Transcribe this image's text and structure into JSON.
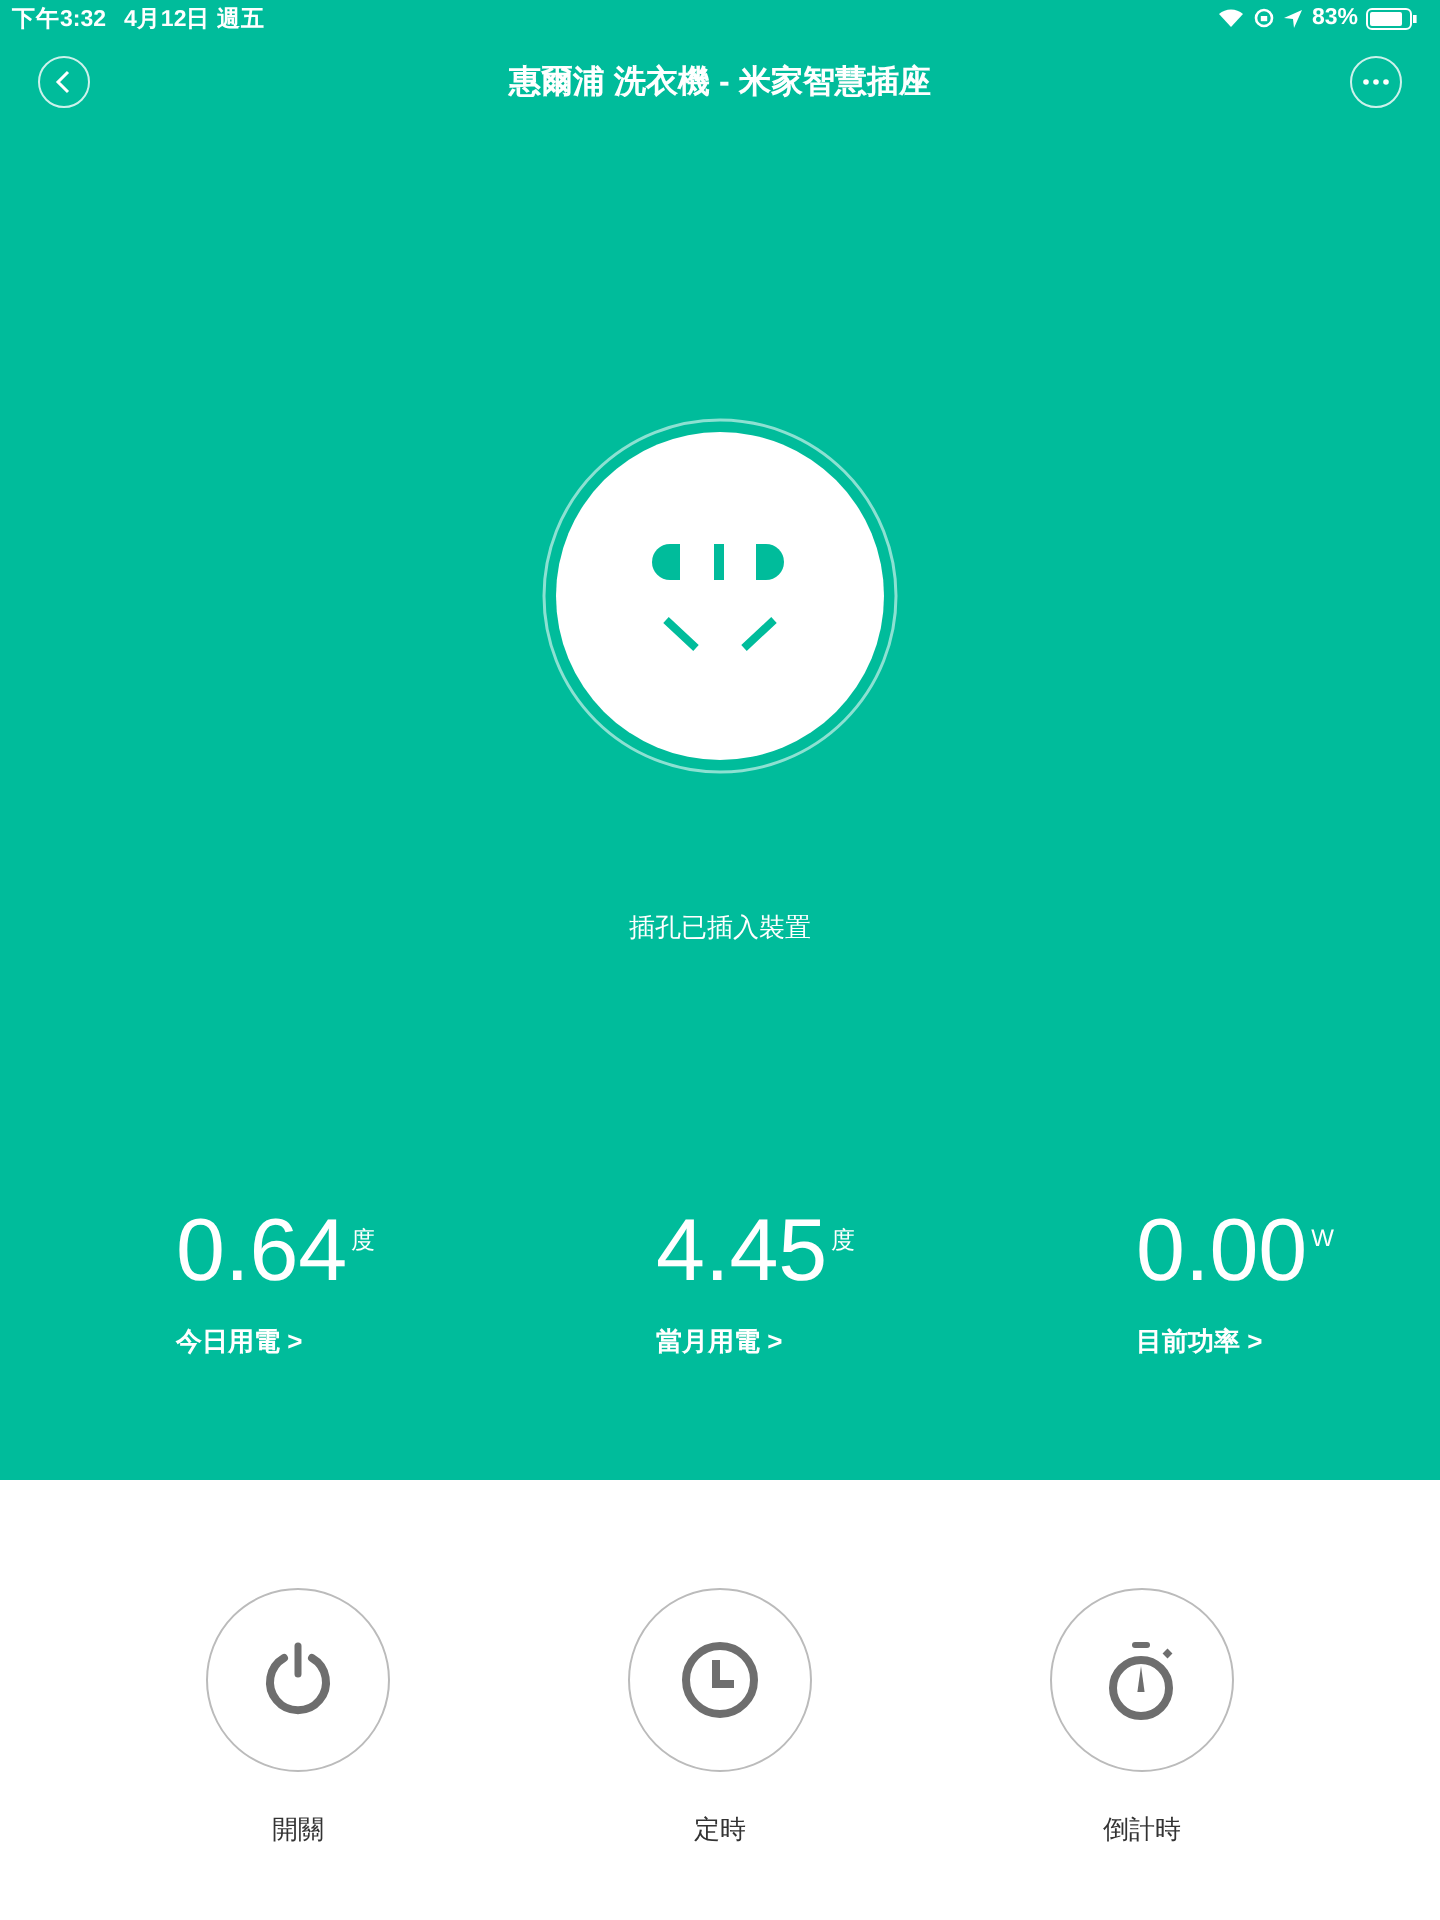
{
  "status_bar": {
    "time": "下午3:32",
    "date": "4月12日 週五",
    "battery": "83%"
  },
  "header": {
    "title": "惠爾浦 洗衣機 - 米家智慧插座"
  },
  "socket": {
    "status": "插孔已插入裝置"
  },
  "stats": [
    {
      "value": "0.64",
      "unit": "度",
      "label": "今日用電 >"
    },
    {
      "value": "4.45",
      "unit": "度",
      "label": "當月用電 >"
    },
    {
      "value": "0.00",
      "unit": "W",
      "label": "目前功率 >"
    }
  ],
  "controls": [
    {
      "kind": "power",
      "label": "開關"
    },
    {
      "kind": "clock",
      "label": "定時"
    },
    {
      "kind": "timer",
      "label": "倒計時"
    }
  ]
}
